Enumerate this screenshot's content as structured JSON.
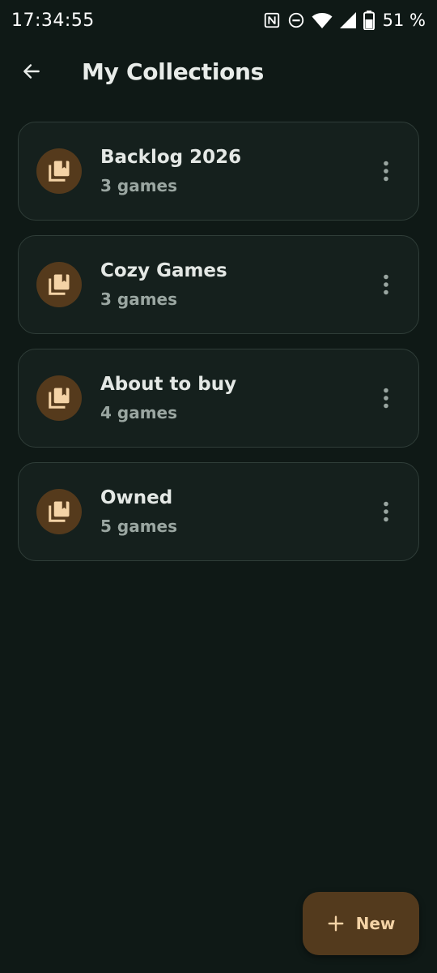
{
  "status_bar": {
    "time": "17:34:55",
    "battery": "51 %",
    "icons": [
      "nfc-icon",
      "do-not-disturb-icon",
      "wifi-icon",
      "signal-icon",
      "battery-icon"
    ]
  },
  "app_bar": {
    "back_icon": "arrow-left-icon",
    "title": "My Collections"
  },
  "collections": [
    {
      "title": "Backlog 2026",
      "count": "3 games"
    },
    {
      "title": "Cozy Games",
      "count": "3 games"
    },
    {
      "title": "About to buy",
      "count": "4 games"
    },
    {
      "title": "Owned",
      "count": "5 games"
    }
  ],
  "fab": {
    "icon": "plus-icon",
    "label": "New"
  },
  "colors": {
    "background": "#0f1916",
    "card_border": "#2f3d38",
    "accent_bg": "#553a1c",
    "accent_fg": "#f4d3a6"
  }
}
